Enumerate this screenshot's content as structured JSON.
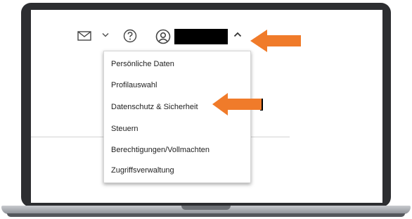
{
  "header": {
    "icons": [
      "mail-icon",
      "chevron-down-icon",
      "help-icon",
      "user-icon",
      "chevron-up-icon"
    ],
    "username": ""
  },
  "menu": {
    "items": [
      {
        "label": "Persönliche Daten"
      },
      {
        "label": "Profilauswahl"
      },
      {
        "label": "Datenschutz & Sicherheit"
      },
      {
        "label": "Steuern"
      },
      {
        "label": "Berechtigungen/Vollmachten"
      },
      {
        "label": "Zugriffsverwaltung"
      }
    ]
  },
  "colors": {
    "arrow": "#f07b2a",
    "laptop_frame": "#2d2e31",
    "menu_border": "#d6d6d6"
  }
}
